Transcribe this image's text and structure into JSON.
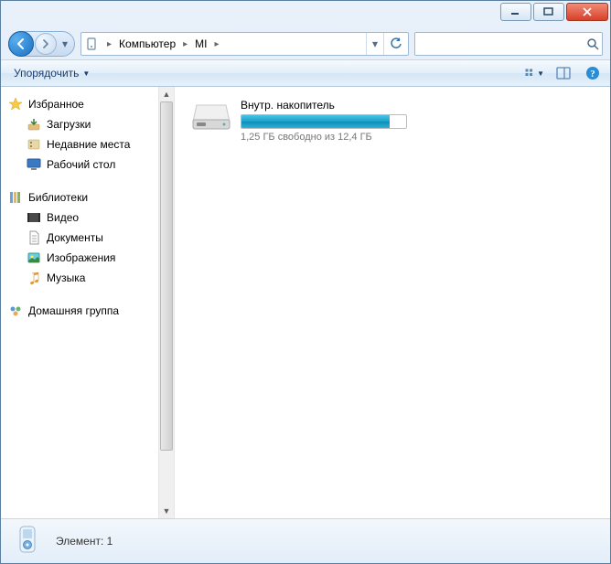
{
  "breadcrumb": {
    "seg1": "Компьютер",
    "seg2": "MI"
  },
  "search": {
    "placeholder": ""
  },
  "toolbar": {
    "organize_label": "Упорядочить"
  },
  "nav": {
    "favorites": {
      "header": "Избранное",
      "items": [
        "Загрузки",
        "Недавние места",
        "Рабочий стол"
      ]
    },
    "libraries": {
      "header": "Библиотеки",
      "items": [
        "Видео",
        "Документы",
        "Изображения",
        "Музыка"
      ]
    },
    "homegroup": {
      "header": "Домашняя группа"
    }
  },
  "drive": {
    "name": "Внутр. накопитель",
    "status": "1,25 ГБ свободно из 12,4 ГБ",
    "used_percent": 90
  },
  "status": {
    "text": "Элемент: 1"
  }
}
